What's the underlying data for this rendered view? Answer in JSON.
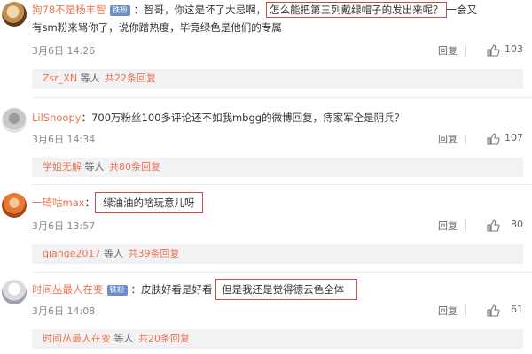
{
  "comments": [
    {
      "user": "狗78不是杨丰智",
      "badge": "铁粉",
      "text_before": "：智哥，你这是坏了大忌啊，",
      "text_highlight": "怎么能把第三列戴绿帽子的发出来呢？",
      "text_after": "一会又",
      "text_line2": "有sm粉来骂你了，说你蹭热度，毕竟绿色是他们的专属",
      "time": "3月6日 14:26",
      "reply_label": "回复",
      "likes": "103",
      "sub_user": "Zsr_XN",
      "sub_mid": " 等人 ",
      "sub_count": "共22条回复"
    },
    {
      "user": "LilSnoopy",
      "text": "：700万粉丝100多评论还不如我mbgg的微博回复，痔家军全是阴兵？",
      "time": "3月6日 14:34",
      "reply_label": "回复",
      "likes": "107",
      "sub_user": "学姐无解",
      "sub_mid": " 等人 ",
      "sub_count": "共80条回复"
    },
    {
      "user": "一琦咕max",
      "text_prefix": "：",
      "text_highlight": "绿油油的啥玩意儿呀",
      "time": "3月6日 13:57",
      "reply_label": "回复",
      "likes": "80",
      "sub_user": "qiange2017",
      "sub_mid": " 等人 ",
      "sub_count": "共39条回复"
    },
    {
      "user": "时间丛最人在变",
      "badge": "铁粉",
      "text_before": "：皮肤好看是好看",
      "text_highlight": "但是我还是觉得德云色全体",
      "time": "3月6日 14:08",
      "reply_label": "回复",
      "likes": "61",
      "sub_user": "时间丛最人在变",
      "sub_mid": " 等人 ",
      "sub_count": "共20条回复"
    }
  ],
  "icons": {
    "like": "thumbs-up-icon"
  },
  "colors": {
    "username": "#eb7350",
    "badge": "#6d8fc9",
    "highlight_box": "#c84a46"
  }
}
